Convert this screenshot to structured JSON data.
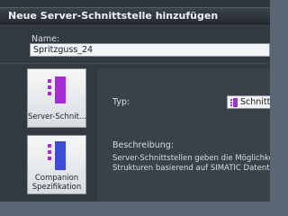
{
  "dialog": {
    "title": "Neue Server-Schnittstelle hinzufügen"
  },
  "name": {
    "label": "Name:",
    "value": "Spritzguss_24"
  },
  "options": [
    {
      "label": "Server-Schnit...",
      "icon": "server-interface-icon"
    },
    {
      "label_line1": "Companion",
      "label_line2": "Spezifikation",
      "icon": "companion-specification-icon"
    }
  ],
  "details": {
    "typ_label": "Typ:",
    "typ_value": "Schnittstelle",
    "description_label": "Beschreibung:",
    "description_lines": [
      "Server-Schnittstellen geben die Möglichkeit,",
      "Strukturen basierend auf SIMATIC Datentypen z"
    ]
  },
  "colors": {
    "magenta_accent": "#a52bd6",
    "blue_accent": "#3e4bd8"
  }
}
